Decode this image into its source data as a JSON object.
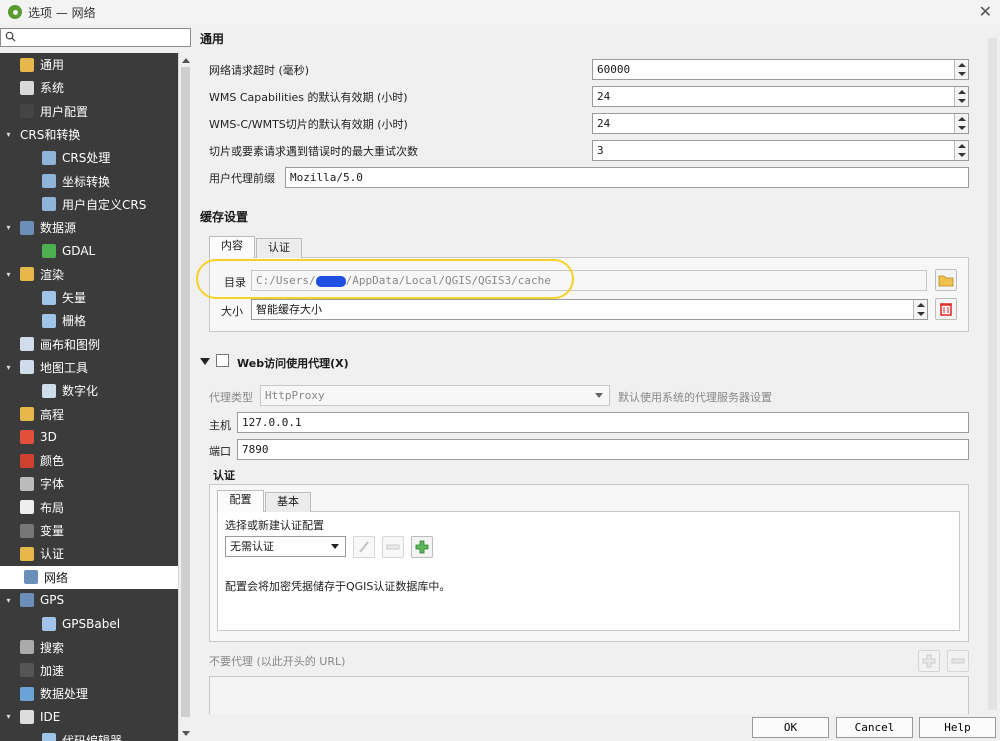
{
  "window": {
    "title": "选项 — 网络"
  },
  "search": {
    "placeholder": ""
  },
  "sidebar": {
    "items": [
      {
        "label": "通用",
        "icon": "wrench-icon",
        "color": "#e6b84b"
      },
      {
        "label": "系统",
        "icon": "system-icon",
        "color": "#d9d9d9"
      },
      {
        "label": "用户配置",
        "icon": "user-icon",
        "color": "#444444"
      },
      {
        "label": "CRS和转换",
        "icon": "",
        "color": ""
      },
      {
        "label": "CRS处理",
        "icon": "globe-icon",
        "color": "#8fb3d9"
      },
      {
        "label": "坐标转换",
        "icon": "transform-icon",
        "color": "#8fb3d9"
      },
      {
        "label": "用户自定义CRS",
        "icon": "custom-crs-icon",
        "color": "#8fb3d9"
      },
      {
        "label": "数据源",
        "icon": "table-icon",
        "color": "#6b8fb8"
      },
      {
        "label": "GDAL",
        "icon": "gdal-icon",
        "color": "#4caf50"
      },
      {
        "label": "渲染",
        "icon": "brush-icon",
        "color": "#e6b84b"
      },
      {
        "label": "矢量",
        "icon": "vector-icon",
        "color": "#9fc4e8"
      },
      {
        "label": "栅格",
        "icon": "raster-icon",
        "color": "#9fc4e8"
      },
      {
        "label": "画布和图例",
        "icon": "canvas-icon",
        "color": "#cfdcea"
      },
      {
        "label": "地图工具",
        "icon": "map-tools-icon",
        "color": "#cfdcea"
      },
      {
        "label": "数字化",
        "icon": "digitize-icon",
        "color": "#cfdcea"
      },
      {
        "label": "高程",
        "icon": "elevation-icon",
        "color": "#e6b84b"
      },
      {
        "label": "3D",
        "icon": "cube-icon",
        "color": "#e0503a"
      },
      {
        "label": "颜色",
        "icon": "color-icon",
        "color": "#d0402f"
      },
      {
        "label": "字体",
        "icon": "font-icon",
        "color": "#bbbbbb"
      },
      {
        "label": "布局",
        "icon": "layout-icon",
        "color": "#eeeeee"
      },
      {
        "label": "变量",
        "icon": "variable-icon",
        "color": "#777777"
      },
      {
        "label": "认证",
        "icon": "lock-icon",
        "color": "#e6b84b"
      },
      {
        "label": "网络",
        "icon": "network-icon",
        "color": "#6b8fb8"
      },
      {
        "label": "GPS",
        "icon": "gps-icon",
        "color": "#6b8fb8"
      },
      {
        "label": "GPSBabel",
        "icon": "gpsbabel-icon",
        "color": "#9fc4e8"
      },
      {
        "label": "搜索",
        "icon": "search-icon",
        "color": "#aaaaaa"
      },
      {
        "label": "加速",
        "icon": "accelerate-icon",
        "color": "#555555"
      },
      {
        "label": "数据处理",
        "icon": "gear-icon",
        "color": "#6ba3d6"
      },
      {
        "label": "IDE",
        "icon": "ide-icon",
        "color": "#dddddd"
      },
      {
        "label": "代码编辑器",
        "icon": "code-editor-icon",
        "color": "#9fc4e8"
      }
    ]
  },
  "general": {
    "title": "通用",
    "timeout_label": "网络请求超时 (毫秒)",
    "timeout_value": "60000",
    "wms_cap_label": "WMS Capabilities 的默认有效期 (小时)",
    "wms_cap_value": "24",
    "wmsc_label": "WMS-C/WMTS切片的默认有效期 (小时)",
    "wmsc_value": "24",
    "retry_label": "切片或要素请求遇到错误时的最大重试次数",
    "retry_value": "3",
    "ua_label": "用户代理前缀",
    "ua_value": "Mozilla/5.0"
  },
  "cache": {
    "title": "缓存设置",
    "tab_content": "内容",
    "tab_auth": "认证",
    "dir_label": "目录",
    "dir_value": "C:/Users/",
    "dir_value_tail": "/AppData/Local/QGIS/QGIS3/cache",
    "size_label": "大小",
    "size_value": "智能缓存大小"
  },
  "proxy": {
    "title": "Web访问使用代理(X)",
    "type_label": "代理类型",
    "type_value": "HttpProxy",
    "type_note": "默认使用系统的代理服务器设置",
    "host_label": "主机",
    "host_value": "127.0.0.1",
    "port_label": "端口",
    "port_value": "7890",
    "auth_title": "认证",
    "tab_config": "配置",
    "tab_basic": "基本",
    "choose_label": "选择或新建认证配置",
    "auth_combo": "无需认证",
    "auth_note": "配置会将加密凭据储存于QGIS认证数据库中。",
    "exclude_label": "不要代理 (以此开头的 URL)"
  },
  "buttons": {
    "ok": "OK",
    "cancel": "Cancel",
    "help": "Help"
  },
  "colors": {
    "tree_bg": "#3b3b3b",
    "highlight": "#f5d228",
    "redact": "#1f4fe0"
  }
}
